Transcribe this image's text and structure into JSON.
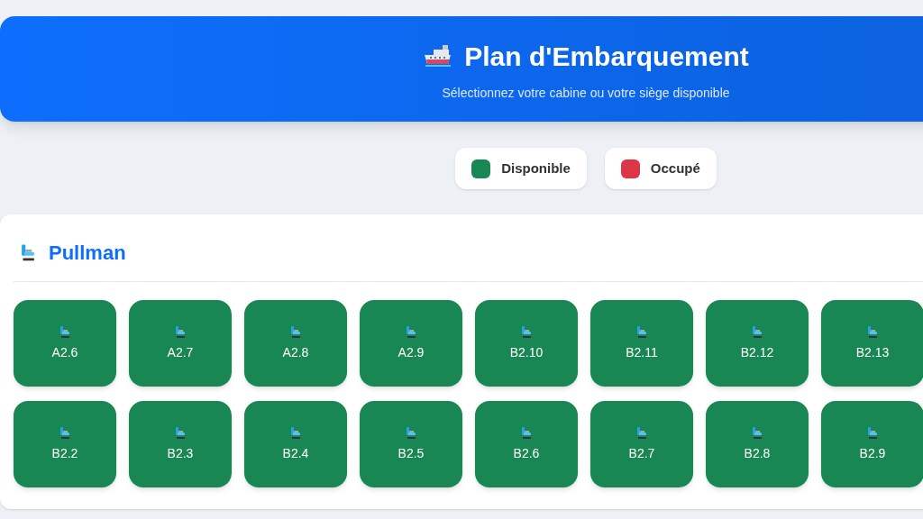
{
  "header": {
    "title": "Plan d'Embarquement",
    "subtitle": "Sélectionnez votre cabine ou votre siège disponible"
  },
  "legend": [
    {
      "label": "Disponible",
      "color": "#198754"
    },
    {
      "label": "Occupé",
      "color": "#dc3545"
    }
  ],
  "section": {
    "title": "Pullman",
    "seats": [
      {
        "label": "A2.6",
        "occupied": false
      },
      {
        "label": "A2.7",
        "occupied": false
      },
      {
        "label": "A2.8",
        "occupied": false
      },
      {
        "label": "A2.9",
        "occupied": false
      },
      {
        "label": "B2.10",
        "occupied": false
      },
      {
        "label": "B2.11",
        "occupied": false
      },
      {
        "label": "B2.12",
        "occupied": false
      },
      {
        "label": "B2.13",
        "occupied": false
      },
      {
        "label": "B2.2",
        "occupied": false
      },
      {
        "label": "B2.3",
        "occupied": false
      },
      {
        "label": "B2.4",
        "occupied": false
      },
      {
        "label": "B2.5",
        "occupied": false
      },
      {
        "label": "B2.6",
        "occupied": false
      },
      {
        "label": "B2.7",
        "occupied": false
      },
      {
        "label": "B2.8",
        "occupied": false
      },
      {
        "label": "B2.9",
        "occupied": false
      }
    ]
  }
}
